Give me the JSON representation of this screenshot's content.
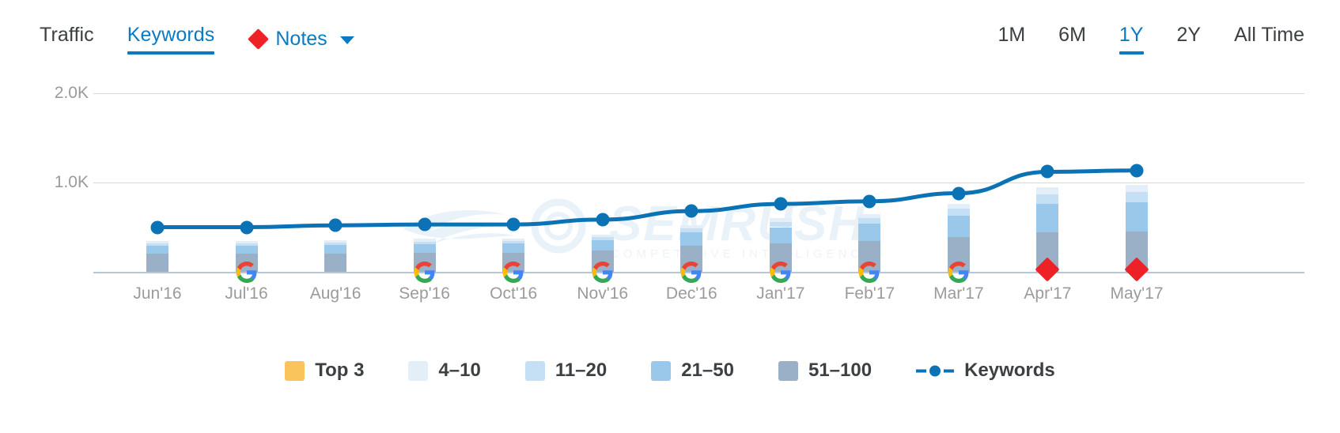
{
  "header": {
    "tabs": [
      {
        "label": "Traffic",
        "active": false
      },
      {
        "label": "Keywords",
        "active": true
      }
    ],
    "notes": {
      "label": "Notes",
      "marker_color": "#ec2227",
      "caret": "chevron-down-icon"
    },
    "ranges": [
      {
        "label": "1M",
        "active": false
      },
      {
        "label": "6M",
        "active": false
      },
      {
        "label": "1Y",
        "active": true
      },
      {
        "label": "2Y",
        "active": false
      },
      {
        "label": "All Time",
        "active": false
      }
    ],
    "accent_color": "#0a7ac2"
  },
  "watermark": {
    "text": "SEMRUSH",
    "subtext": "COMPETITIVE INTELLIGENCE"
  },
  "legend": [
    {
      "label": "Top 3",
      "color": "#f9c45c",
      "type": "swatch"
    },
    {
      "label": "4–10",
      "color": "#e3eef9",
      "type": "swatch"
    },
    {
      "label": "11–20",
      "color": "#c5e0f4",
      "type": "swatch"
    },
    {
      "label": "21–50",
      "color": "#9ac8ea",
      "type": "swatch"
    },
    {
      "label": "51–100",
      "color": "#9ab0c6",
      "type": "swatch"
    },
    {
      "label": "Keywords",
      "color": "#0b72b5",
      "type": "line-marker"
    }
  ],
  "chart_data": {
    "type": "bar",
    "title": "Keywords",
    "xlabel": "",
    "ylabel": "",
    "ylim": [
      0,
      2000
    ],
    "yticks": [
      1000,
      2000
    ],
    "ytick_labels": [
      "1.0K",
      "2.0K"
    ],
    "grid": true,
    "legend_position": "bottom",
    "categories": [
      "Jun'16",
      "Jul'16",
      "Aug'16",
      "Sep'16",
      "Oct'16",
      "Nov'16",
      "Dec'16",
      "Jan'17",
      "Feb'17",
      "Mar'17",
      "Apr'17",
      "May'17"
    ],
    "stacked": true,
    "series": [
      {
        "name": "Top 3",
        "color": "#f9c45c",
        "values": [
          0,
          0,
          0,
          0,
          0,
          0,
          0,
          0,
          0,
          0,
          0,
          0
        ]
      },
      {
        "name": "4–10",
        "color": "#e3eef9",
        "values": [
          30,
          30,
          30,
          30,
          30,
          35,
          40,
          45,
          50,
          60,
          75,
          80
        ]
      },
      {
        "name": "11–20",
        "color": "#c5e0f4",
        "values": [
          25,
          25,
          25,
          30,
          30,
          35,
          45,
          55,
          60,
          75,
          110,
          115
        ]
      },
      {
        "name": "21–50",
        "color": "#9ac8ea",
        "values": [
          90,
          90,
          95,
          100,
          100,
          115,
          150,
          180,
          195,
          240,
          320,
          330
        ]
      },
      {
        "name": "51–100",
        "color": "#9ab0c6",
        "values": [
          200,
          200,
          205,
          210,
          215,
          235,
          290,
          320,
          345,
          390,
          440,
          450
        ]
      }
    ],
    "line_series": {
      "name": "Keywords",
      "color": "#0b72b5",
      "values": [
        500,
        500,
        520,
        530,
        530,
        585,
        680,
        760,
        790,
        880,
        1120,
        1135
      ]
    },
    "annotations": [
      {
        "x": "Apr'17",
        "type": "note-marker",
        "color": "#ec2227"
      },
      {
        "x": "May'17",
        "type": "note-marker",
        "color": "#ec2227"
      }
    ],
    "axis_icons": {
      "name": "google-icon",
      "months": [
        "Jul'16",
        "Sep'16",
        "Oct'16",
        "Nov'16",
        "Dec'16",
        "Jan'17",
        "Feb'17",
        "Mar'17"
      ]
    }
  }
}
